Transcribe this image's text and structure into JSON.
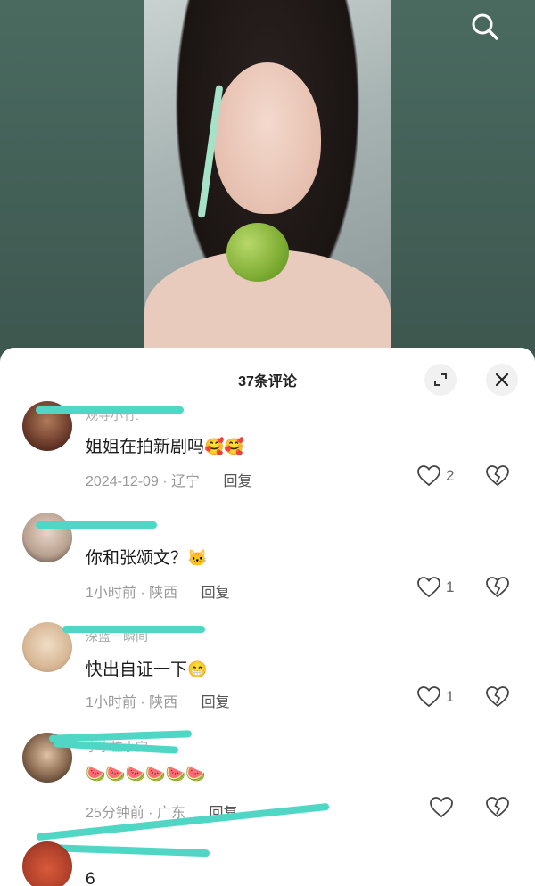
{
  "header": {
    "title": "37条评论"
  },
  "icons": {
    "search": "search-icon",
    "expand": "expand-icon",
    "close": "close-icon",
    "like": "heart-outline-icon",
    "dislike": "broken-heart-icon"
  },
  "colors": {
    "background": "#3f5a51",
    "sheet": "#ffffff",
    "scribble": "#4fd6c4",
    "meta": "#9a9a9a"
  },
  "comments": [
    {
      "username": "观寻小竹.",
      "text": "姐姐在拍新剧吗",
      "emoji": "🥰🥰",
      "time": "2024-12-09",
      "location": "辽宁",
      "reply": "回复",
      "likes": "2"
    },
    {
      "username": "",
      "text": "你和张颂文？",
      "emoji": "🐱",
      "time": "1小时前",
      "location": "陕西",
      "reply": "回复",
      "likes": "1"
    },
    {
      "username": "深蓝一瞬间",
      "text": "快出自证一下",
      "emoji": "😁",
      "time": "1小时前",
      "location": "陕西",
      "reply": "回复",
      "likes": "1"
    },
    {
      "username": "小小桂小宝",
      "text": "",
      "emoji": "🍉🍉🍉🍉🍉🍉",
      "time": "25分钟前",
      "location": "广东",
      "reply": "回复",
      "likes": ""
    },
    {
      "username": "",
      "text": "6",
      "emoji": "",
      "time": "",
      "location": "",
      "reply": "",
      "likes": ""
    }
  ]
}
